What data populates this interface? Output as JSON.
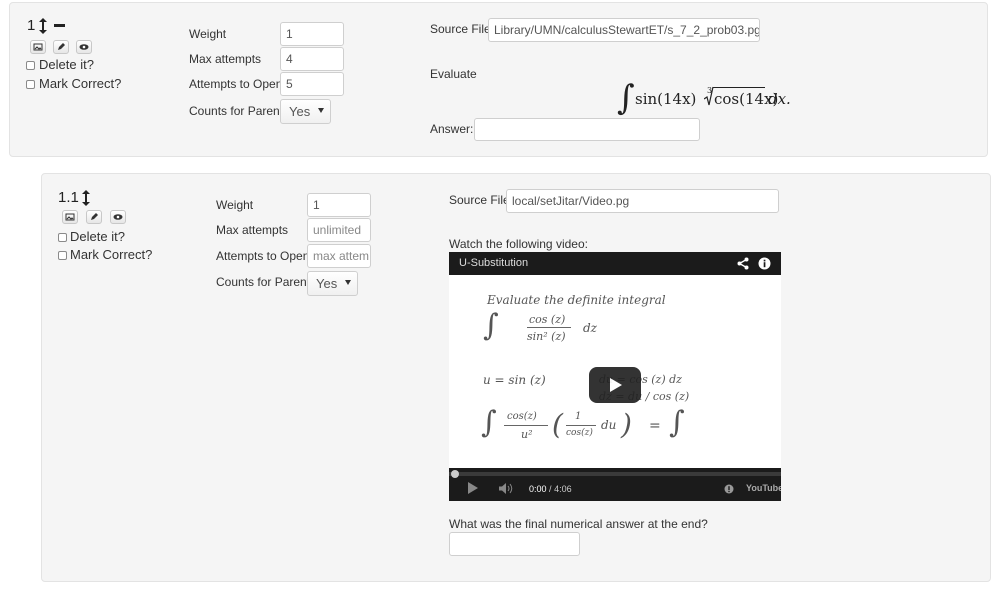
{
  "problem1": {
    "number": "1",
    "weight_label": "Weight",
    "weight_value": "1",
    "max_attempts_label": "Max attempts",
    "max_attempts_value": "4",
    "attempts_open_label": "Attempts to Open",
    "attempts_open_value": "5",
    "counts_parent_label": "Counts for Parent",
    "counts_parent_value": "Yes",
    "delete_label": "Delete it?",
    "mark_correct_label": "Mark Correct?",
    "source_label": "Source File",
    "source_value": "Library/UMN/calculusStewartET/s_7_2_prob03.pg",
    "prompt": "Evaluate",
    "integral_integrand": "sin(14x)",
    "integral_root_index": "3",
    "integral_radicand": "cos(14x)",
    "integral_tail": "dx.",
    "answer_label": "Answer:",
    "answer_value": ""
  },
  "problem2": {
    "number": "1.1",
    "weight_label": "Weight",
    "weight_value": "1",
    "max_attempts_label": "Max attempts",
    "max_attempts_placeholder": "unlimited",
    "attempts_open_label": "Attempts to Open",
    "attempts_open_placeholder": "max attem",
    "counts_parent_label": "Counts for Parent",
    "counts_parent_value": "Yes",
    "delete_label": "Delete it?",
    "mark_correct_label": "Mark Correct?",
    "source_label": "Source File",
    "source_value": "local/setJitar/Video.pg",
    "video_prompt": "Watch the following video:",
    "video": {
      "title": "U-Substitution",
      "current_time": "0:00",
      "duration": "4:06",
      "time_separator": "/",
      "progress": 0,
      "brand": "YouTube",
      "board_lines": [
        "Evaluate the definite integral",
        "cos (z)",
        "sin² (z)",
        "dz",
        "u = sin (z)",
        "du = cos (z) dz",
        "dz = du / cos (z)",
        "cos(z)",
        "u²",
        "1",
        "cos(z)",
        "du",
        "="
      ]
    },
    "question": "What was the final numerical answer at the end?",
    "answer_value": ""
  },
  "colors": {
    "panel_bg": "#f5f5f5",
    "panel_border": "#e3e3e3",
    "video_bar": "#1b1b1b"
  }
}
